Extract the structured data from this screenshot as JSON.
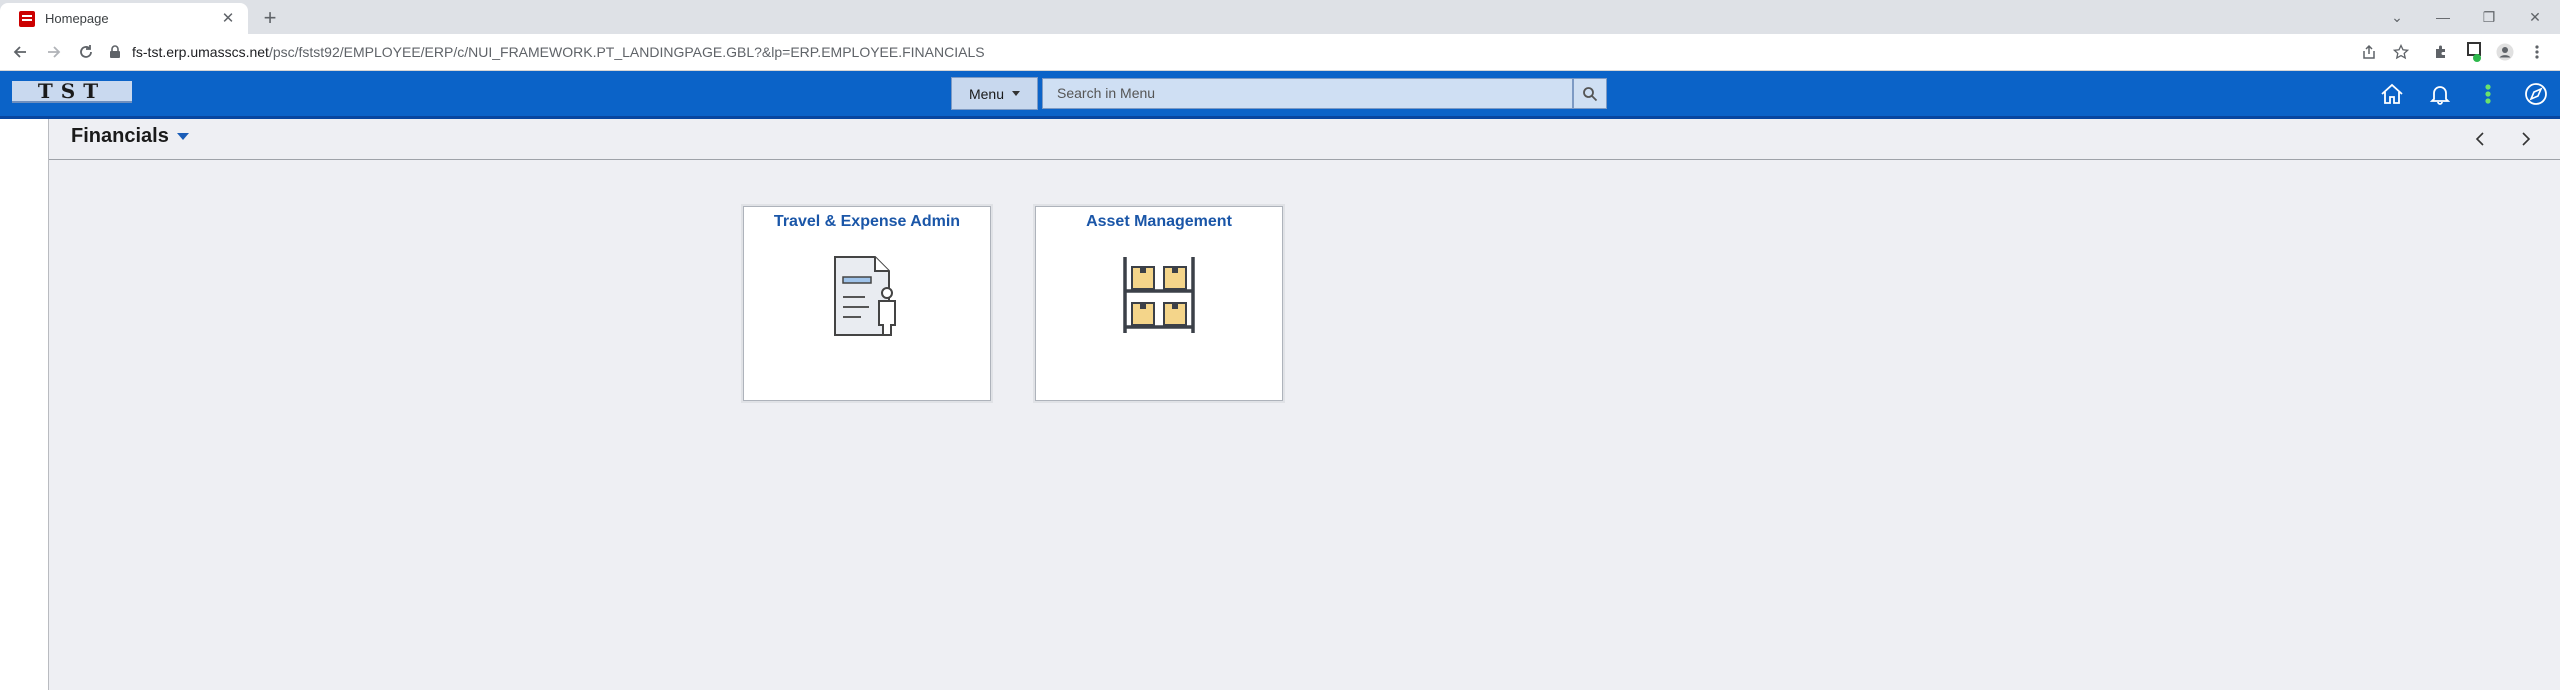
{
  "browser": {
    "tab_title": "Homepage",
    "url_host": "fs-tst.erp.umasscs.net",
    "url_path": "/psc/fstst92/EMPLOYEE/ERP/c/NUI_FRAMEWORK.PT_LANDINGPAGE.GBL?&lp=ERP.EMPLOYEE.FINANCIALS"
  },
  "header": {
    "logo_text": "TST",
    "menu_label": "Menu",
    "search_placeholder": "Search in Menu",
    "icons": [
      "home-icon",
      "bell-icon",
      "action-icon",
      "navbar-compass-icon"
    ],
    "accent_color": "#0b63c8"
  },
  "page": {
    "title": "Financials"
  },
  "tiles": [
    {
      "label": "Travel & Expense Admin",
      "icon": "document-person-icon"
    },
    {
      "label": "Asset Management",
      "icon": "shelving-boxes-icon"
    }
  ]
}
